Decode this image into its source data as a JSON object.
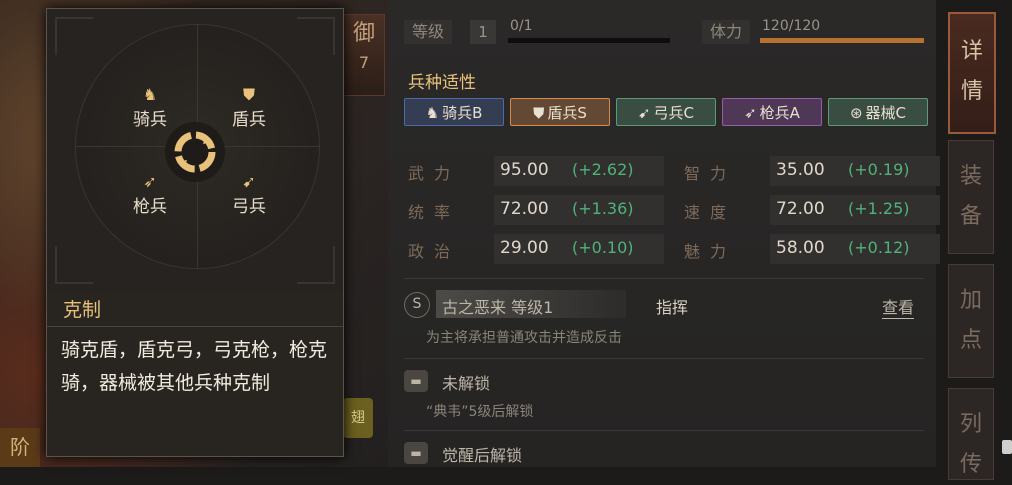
{
  "scene": {
    "defense_label": "御",
    "defense_value": "7",
    "step_label": "阶",
    "yellow_badge": "翅"
  },
  "popup": {
    "units": {
      "cavalry": {
        "label": "骑兵",
        "icon": "horse-icon"
      },
      "shield": {
        "label": "盾兵",
        "icon": "shield-icon"
      },
      "spear": {
        "label": "枪兵",
        "icon": "spear-icon"
      },
      "bow": {
        "label": "弓兵",
        "icon": "bow-icon"
      }
    },
    "counter_title": "克制",
    "counter_text": "骑克盾，盾克弓，弓克枪，枪克骑，器械被其他兵种克制"
  },
  "panel": {
    "level_label": "等级",
    "level_value": "1",
    "exp_text": "0/1",
    "exp_fraction": 0,
    "stamina_label": "体力",
    "stamina_text": "120/120",
    "stamina_fraction": 1,
    "affinity_title": "兵种适性",
    "affinities": [
      {
        "label": "骑兵B",
        "icon": "horse-icon",
        "color": "#4a6aa8"
      },
      {
        "label": "盾兵S",
        "icon": "shield-icon",
        "color": "#d88a4a"
      },
      {
        "label": "弓兵C",
        "icon": "bow-icon",
        "color": "#5a9a78"
      },
      {
        "label": "枪兵A",
        "icon": "spear-icon",
        "color": "#9a5ab0"
      },
      {
        "label": "器械C",
        "icon": "wheel-icon",
        "color": "#5a9a78"
      }
    ],
    "stats": [
      {
        "label": "武力",
        "value": "95.00",
        "bonus": "(+2.62)"
      },
      {
        "label": "智力",
        "value": "35.00",
        "bonus": "(+0.19)"
      },
      {
        "label": "统率",
        "value": "72.00",
        "bonus": "(+1.36)"
      },
      {
        "label": "速度",
        "value": "72.00",
        "bonus": "(+1.25)"
      },
      {
        "label": "政治",
        "value": "29.00",
        "bonus": "(+0.10)"
      },
      {
        "label": "魅力",
        "value": "58.00",
        "bonus": "(+0.12)"
      }
    ],
    "skills": [
      {
        "icon_text": "S",
        "name": "古之恶来 等级1",
        "type": "指挥",
        "view": "查看",
        "desc": "为主将承担普通攻击并造成反击"
      },
      {
        "name": "未解锁",
        "desc": "“典韦”5级后解锁"
      },
      {
        "name": "觉醒后解锁"
      }
    ]
  },
  "tabs": [
    "详情",
    "装备",
    "加点",
    "列传"
  ]
}
